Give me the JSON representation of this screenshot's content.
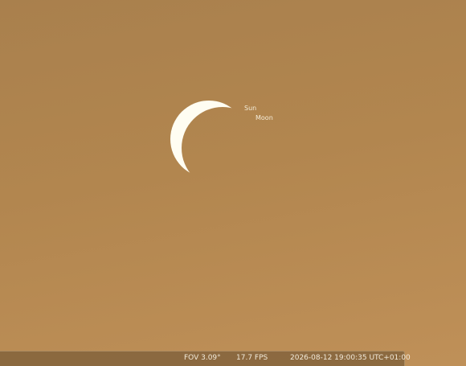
{
  "sky": {
    "labels": {
      "sun": "Sun",
      "moon": "Moon"
    },
    "colors": {
      "sky": "#b2864f",
      "sun_crescent": "#fffdf2"
    }
  },
  "status_bar": {
    "fov": "FOV 3.09°",
    "fps": "17.7 FPS",
    "datetime": "2026-08-12 19:00:35 UTC+01:00"
  }
}
